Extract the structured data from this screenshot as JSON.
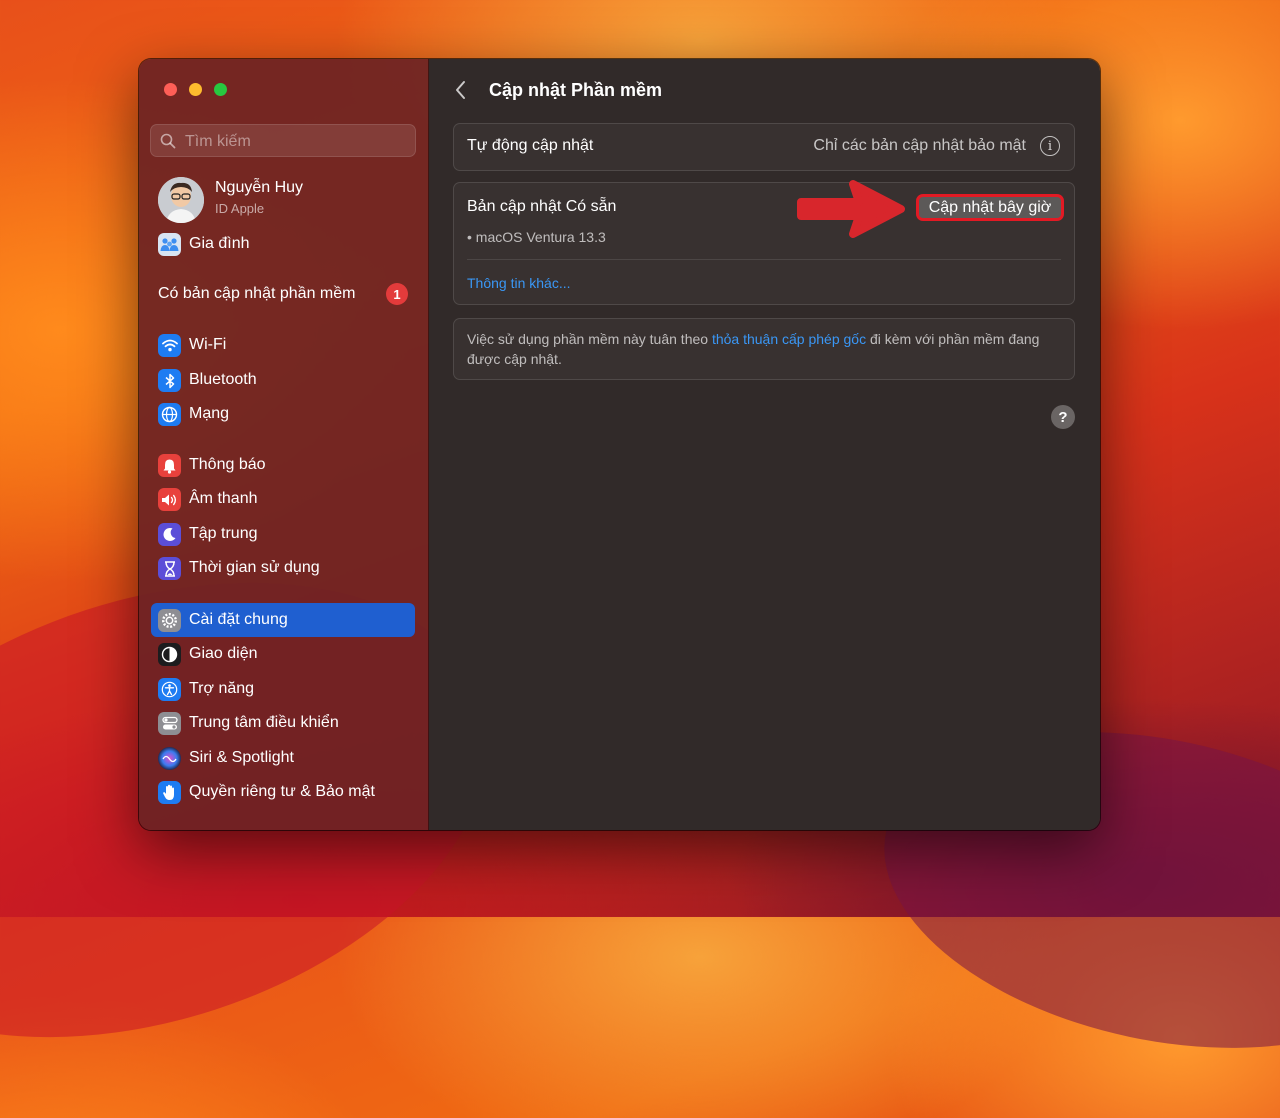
{
  "sidebar": {
    "search": {
      "placeholder": "Tìm kiếm"
    },
    "user": {
      "name": "Nguyễn Huy",
      "subtitle": "ID Apple"
    },
    "family": {
      "label": "Gia đình"
    },
    "update_notice": {
      "label": "Có bản cập nhật phần mềm",
      "badge": "1"
    },
    "items": [
      {
        "label": "Wi-Fi",
        "icon": "wifi-icon",
        "color": "#1e7cf2"
      },
      {
        "label": "Bluetooth",
        "icon": "bluetooth-icon",
        "color": "#1e7cf2"
      },
      {
        "label": "Mạng",
        "icon": "globe-icon",
        "color": "#1e7cf2"
      },
      {
        "label": "Thông báo",
        "icon": "bell-icon",
        "color": "#e8413c"
      },
      {
        "label": "Âm thanh",
        "icon": "speaker-icon",
        "color": "#e8413c"
      },
      {
        "label": "Tập trung",
        "icon": "moon-icon",
        "color": "#5b4ed8"
      },
      {
        "label": "Thời gian sử dụng",
        "icon": "hourglass-icon",
        "color": "#5b4ed8"
      },
      {
        "label": "Cài đặt chung",
        "icon": "gear-icon",
        "color": "#8e8e93",
        "selected": true
      },
      {
        "label": "Giao diện",
        "icon": "appearance-icon",
        "color": "#1c1c1e"
      },
      {
        "label": "Trợ năng",
        "icon": "accessibility-icon",
        "color": "#1e7cf2"
      },
      {
        "label": "Trung tâm điều khiển",
        "icon": "control-center-icon",
        "color": "#8e8e93"
      },
      {
        "label": "Siri & Spotlight",
        "icon": "siri-icon",
        "color": "#2b2b7a"
      },
      {
        "label": "Quyền riêng tư & Bảo mật",
        "icon": "hand-icon",
        "color": "#1e7cf2"
      }
    ]
  },
  "main": {
    "title": "Cập nhật Phần mềm",
    "auto_update": {
      "label": "Tự động cập nhật",
      "value": "Chỉ các bản cập nhật bảo mật"
    },
    "available": {
      "title": "Bản cập nhật Có sẵn",
      "item": "• macOS Ventura 13.3",
      "update_button": "Cập nhật bây giờ",
      "more_info": "Thông tin khác..."
    },
    "license": {
      "text_before": "Việc sử dụng phần mềm này tuân theo ",
      "link": "thỏa thuận cấp phép gốc",
      "text_after": " đi kèm với phần mềm đang được cập nhật."
    },
    "help_label": "?"
  },
  "colors": {
    "accent": "#1f5fd0",
    "link": "#3a97f5",
    "badge": "#e33b3b",
    "annotation_arrow": "#e21a24"
  }
}
